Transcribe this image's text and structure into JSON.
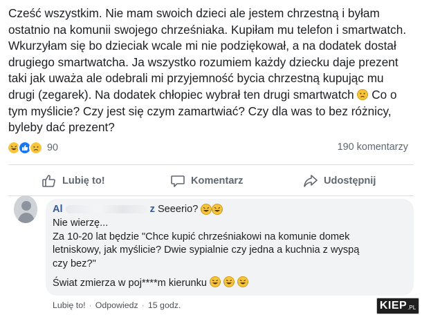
{
  "post": {
    "lines": [
      "Cześć wszystkim. Nie mam swoich dzieci ale jestem chrzestną i byłam",
      "ostatnio na komunii swojego chrześniaka. Kupiłam mu telefon i smartwatch.",
      "Wkurzyłam się bo dzieciak wcale mi nie podziękował, a na dodatek dostał",
      "drugiego smartwatcha. Ja wszystko rozumiem każdy dziecku daje prezent",
      "taki jak uważa ale odebrali mi przyjemność bycia chrzestną kupując mu",
      "drugi (zegarek). Na dodatek chłopiec wybrał ten drugi smartwatch",
      "Co o",
      "tym myślicie? Czy jest się czym zamartwiać? Czy dla was to bez różnicy,",
      "byleby dać prezent?"
    ],
    "icons": {
      "sad": "sad-face-emoji",
      "laugh": "crying-laughing-emoji"
    }
  },
  "reactions": {
    "icons": [
      "crying-laughing-reaction-icon",
      "like-reaction-icon",
      "sad-reaction-icon"
    ],
    "count": "90",
    "comments_count": "190 komentarzy"
  },
  "actions": {
    "like": "Lubię to!",
    "comment": "Komentarz",
    "share": "Udostępnij"
  },
  "comment": {
    "author_visible_start": "Al",
    "author_visible_end": "z",
    "author_inline_text": "Seeerio?",
    "lines": [
      "Nie wierzę...",
      "Za 10-20 lat będzie \"Chce kupić chrześniakowi na komunie domek",
      "letniskowy, jak myślicie? Dwie sypialnie czy jedna a kuchnia z wyspą",
      "czy bez?\"",
      "Świat zmierza w poj****m kierunku"
    ],
    "footer": {
      "like": "Lubię to!",
      "reply": "Odpowiedz",
      "time": "15 godz."
    }
  },
  "watermark": {
    "main": "KIEP",
    "tld": ".PL"
  },
  "colors": {
    "text": "#1c1e21",
    "muted": "#606770",
    "link": "#385898",
    "bubble": "#f2f3f5",
    "emoji": "#f7c43a"
  }
}
